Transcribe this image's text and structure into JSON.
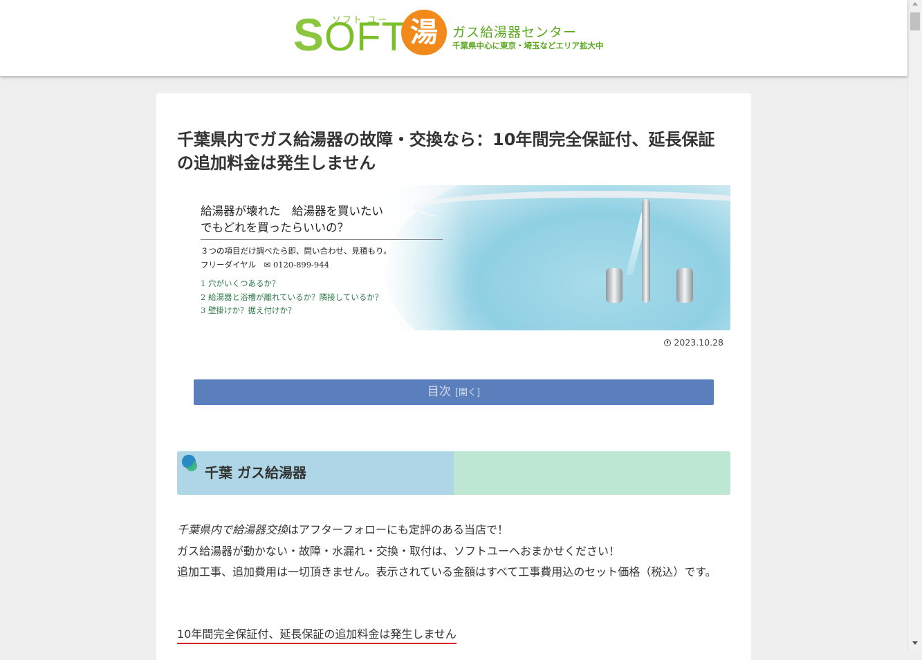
{
  "header": {
    "logo_s": "S",
    "logo_oft": "OFT",
    "logo_ruby": "ソフト ユー",
    "logo_yu": "湯",
    "site_name": "ガス給湯器センター",
    "site_tagline": "千葉県中心に東京・埼玉などエリア拡大中"
  },
  "article": {
    "title": "千葉県内でガス給湯器の故障・交換なら：10年間完全保証付、延長保証の追加料金は発生しません",
    "date": "2023.10.28",
    "hero": {
      "headline_1": "給湯器が壊れた　給湯器を買いたい",
      "headline_2": "でもどれを買ったらいいの？",
      "line_1": "３つの項目だけ調べたら即、問い合わせ、見積もり。",
      "line_2": "フリーダイヤル　✉ 0120-899-944",
      "items": [
        "1 穴がいくつあるか？",
        "2 給湯器と浴槽が離れているか？隣接しているか？",
        "3 壁掛けか？据え付けか？"
      ]
    },
    "toc_label": "目次",
    "toc_toggle": "[開く]",
    "section_heading": "千葉 ガス給湯器",
    "para_1_em": "千葉県内で給湯器交換",
    "para_1_rest": "はアフターフォローにも定評のある当店で！",
    "para_2": "ガス給湯器が動かない・故障・水漏れ・交換・取付は、ソフトユーへおまかせください！",
    "para_3": "追加工事、追加費用は一切頂きません。表示されている金額はすべて工事費用込のセット価格（税込）です。",
    "underlined": "10年間完全保証付、延長保証の追加料金は発生しません"
  },
  "colors": {
    "toc_bg": "#5b7fbc",
    "heading_left": "#aed6e6",
    "heading_right": "#bde6d3",
    "underline": "#d9232d",
    "logo_green": "#7dbf2a",
    "logo_orange": "#f28a1b"
  }
}
